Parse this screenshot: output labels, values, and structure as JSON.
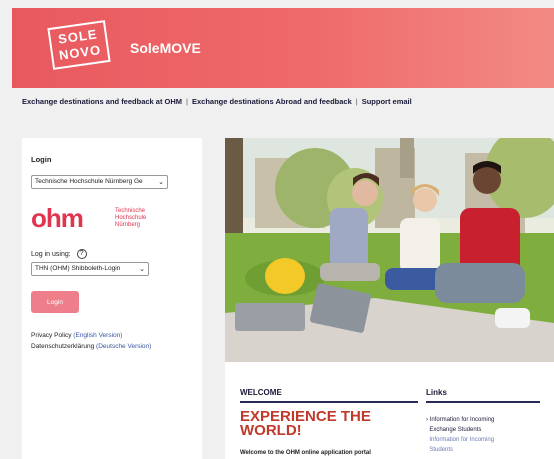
{
  "header": {
    "logo_line1": "SOLE",
    "logo_line2": "NOVO",
    "app_name": "SoleMOVE"
  },
  "topnav": {
    "links": [
      "Exchange destinations and feedback at OHM",
      "Exchange destinations Abroad and feedback",
      "Support email"
    ],
    "separator": "|"
  },
  "login": {
    "title": "Login",
    "institution_value": "Technische Hochschule Nürnberg Ge",
    "ohm_word": "ohm",
    "ohm_sub1": "Technische",
    "ohm_sub2": "Hochschule",
    "ohm_sub3": "Nürnberg",
    "login_using_label": "Log in using:",
    "help_icon": "?",
    "method_value": "THN (OHM) Shibboleth-Login",
    "login_button": "Login",
    "privacy_label": "Privacy Policy",
    "privacy_link": "(English Version)",
    "datenschutz_label": "Datenschutzerklärung",
    "datenschutz_link": "(Deutsche Version)"
  },
  "welcome": {
    "heading": "WELCOME",
    "headline_line1": "EXPERIENCE THE",
    "headline_line2": "WORLD!",
    "text": "Welcome to the OHM online application portal"
  },
  "links": {
    "heading": "Links",
    "items": [
      "Information for Incoming",
      "Exchange Students",
      "Information for Incoming",
      "Students"
    ]
  },
  "colors": {
    "brand_red": "#e8595f",
    "ohm_red": "#e0344f",
    "headline_red": "#c0392b",
    "navy": "#1a1a3a"
  }
}
